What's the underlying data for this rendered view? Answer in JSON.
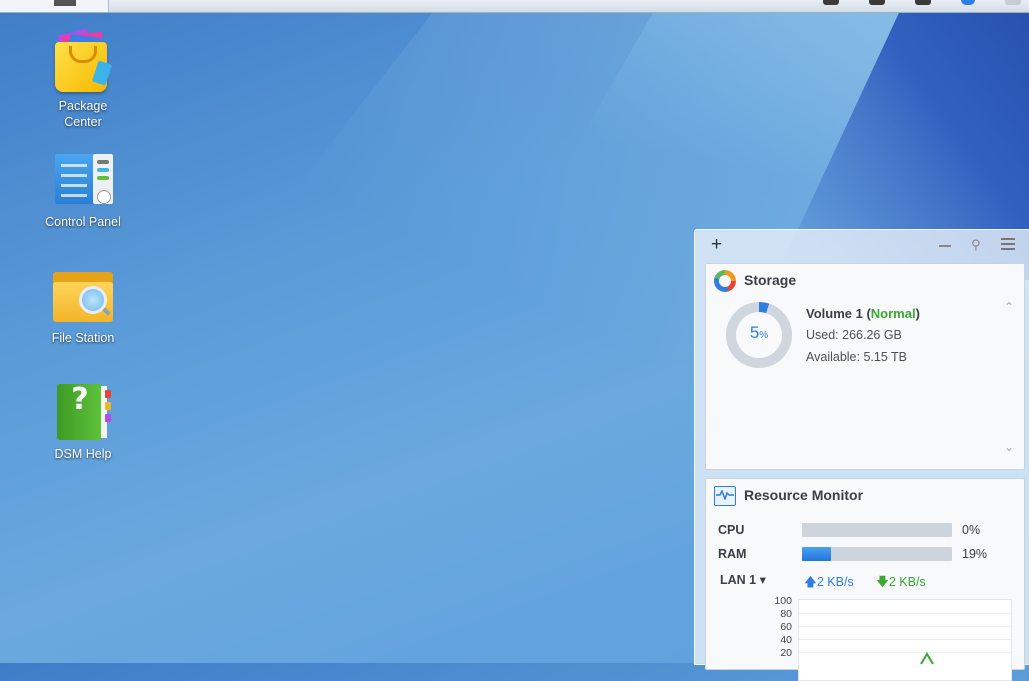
{
  "desktop": {
    "icons": [
      {
        "label_line1": "Package",
        "label_line2": "Center"
      },
      {
        "label": "Control Panel"
      },
      {
        "label": "File Station"
      },
      {
        "label": "DSM Help"
      }
    ]
  },
  "widgets": {
    "storage": {
      "title": "Storage",
      "percent": "5",
      "percent_unit": "%",
      "volume_name": "Volume 1",
      "volume_status": "Normal",
      "used": "Used: 266.26 GB",
      "available": "Available: 5.15 TB",
      "usage_fraction": 0.05
    },
    "resource_monitor": {
      "title": "Resource Monitor",
      "cpu_label": "CPU",
      "cpu_value": "0%",
      "cpu_fraction": 0.0,
      "ram_label": "RAM",
      "ram_value": "19%",
      "ram_fraction": 0.19,
      "lan_label": "LAN 1",
      "upload": "2 KB/s",
      "download": "2 KB/s",
      "chart_ticks": [
        "100",
        "80",
        "60",
        "40",
        "20"
      ]
    }
  },
  "colors": {
    "accent": "#2f7de0",
    "status_ok": "#3aa832"
  }
}
